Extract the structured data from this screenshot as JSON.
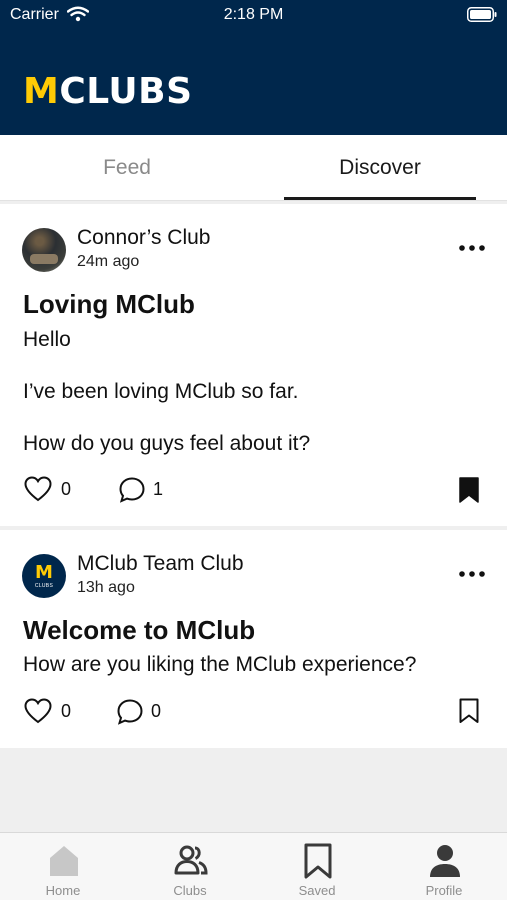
{
  "status_bar": {
    "carrier": "Carrier",
    "time": "2:18 PM"
  },
  "header": {
    "logo_m": "M",
    "logo_rest": "CLUBS"
  },
  "tabs": [
    {
      "label": "Feed",
      "active": false
    },
    {
      "label": "Discover",
      "active": true
    }
  ],
  "posts": [
    {
      "club": "Connor’s Club",
      "time": "24m ago",
      "title": "Loving MClub",
      "body": [
        "Hello",
        "I’ve been loving MClub so far.",
        "How do you guys feel about it?"
      ],
      "likes": "0",
      "comments": "1",
      "saved": true
    },
    {
      "club": "MClub Team Club",
      "time": "13h ago",
      "avatar_m": "M",
      "avatar_text": "CLUBS",
      "title": "Welcome to MClub",
      "body": [
        "How are you liking the MClub experience?"
      ],
      "likes": "0",
      "comments": "0",
      "saved": false
    }
  ],
  "bottom_nav": [
    {
      "label": "Home",
      "icon": "home-icon"
    },
    {
      "label": "Clubs",
      "icon": "people-icon"
    },
    {
      "label": "Saved",
      "icon": "bookmark-icon"
    },
    {
      "label": "Profile",
      "icon": "person-icon"
    }
  ],
  "colors": {
    "brand_navy": "#00274c",
    "brand_maize": "#ffcb05"
  }
}
